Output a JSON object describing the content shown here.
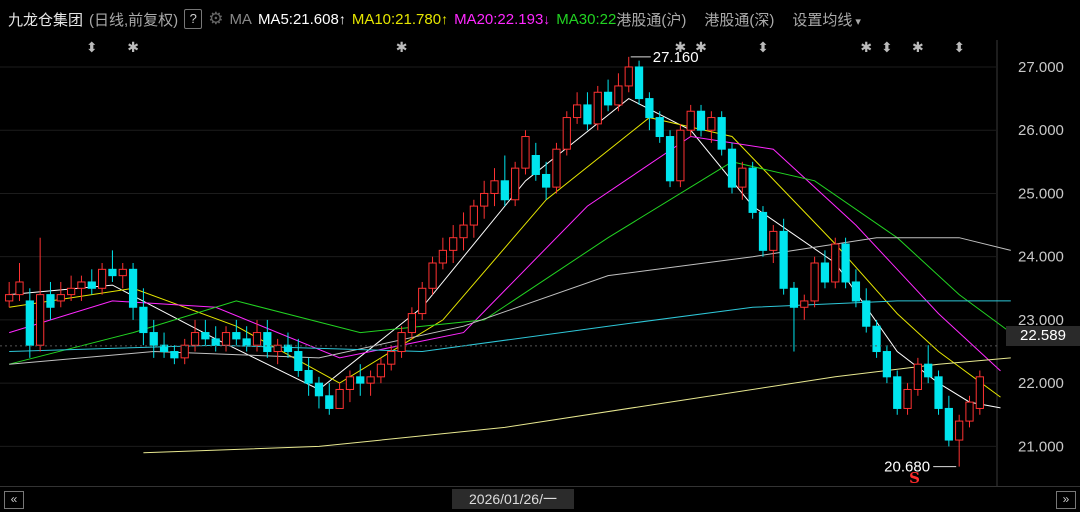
{
  "header": {
    "stock_name": "九龙仓集团",
    "mode": "(日线,前复权)",
    "help": "?",
    "ma_label": "MA",
    "ma5": {
      "text": "MA5:21.608",
      "arrow": "↑",
      "color": "#ffffff"
    },
    "ma10": {
      "text": "MA10:21.780",
      "arrow": "↑",
      "color": "#e6e600"
    },
    "ma20": {
      "text": "MA20:22.193",
      "arrow": "↓",
      "color": "#ff28ff"
    },
    "ma30": {
      "text": "MA30:22",
      "color": "#22d322"
    },
    "link_sh": "港股通(沪)",
    "link_sz": "港股通(深)",
    "settings": "设置均线",
    "settings_caret": "▾"
  },
  "axis": {
    "ticks": [
      "27.000",
      "26.000",
      "25.000",
      "24.000",
      "23.000",
      "22.000",
      "21.000"
    ],
    "current_price": "22.589"
  },
  "annotations": {
    "high": "27.160",
    "low": "20.680",
    "s_marker": "S"
  },
  "bottom": {
    "date": "2026/01/26/一",
    "left_btn": "«",
    "right_btn": "»"
  },
  "chart_data": {
    "type": "candlestick",
    "ylim": [
      20.5,
      27.3
    ],
    "up_color": "#ff3232",
    "down_color": "#00e5ee",
    "candles_ohlc": [
      [
        23.3,
        23.6,
        23.2,
        23.4
      ],
      [
        23.4,
        23.9,
        23.3,
        23.6
      ],
      [
        23.3,
        23.5,
        22.4,
        22.6
      ],
      [
        22.6,
        24.3,
        22.5,
        23.4
      ],
      [
        23.4,
        23.6,
        23.0,
        23.2
      ],
      [
        23.3,
        23.6,
        23.2,
        23.4
      ],
      [
        23.4,
        23.7,
        23.3,
        23.5
      ],
      [
        23.5,
        23.7,
        23.3,
        23.6
      ],
      [
        23.6,
        23.8,
        23.4,
        23.5
      ],
      [
        23.5,
        23.9,
        23.4,
        23.8
      ],
      [
        23.8,
        24.1,
        23.6,
        23.7
      ],
      [
        23.7,
        23.9,
        23.5,
        23.8
      ],
      [
        23.8,
        23.9,
        23.0,
        23.2
      ],
      [
        23.2,
        23.5,
        22.6,
        22.8
      ],
      [
        22.8,
        23.0,
        22.4,
        22.6
      ],
      [
        22.6,
        22.8,
        22.4,
        22.5
      ],
      [
        22.5,
        22.6,
        22.3,
        22.4
      ],
      [
        22.4,
        22.7,
        22.3,
        22.6
      ],
      [
        22.6,
        23.0,
        22.5,
        22.8
      ],
      [
        22.8,
        23.0,
        22.6,
        22.7
      ],
      [
        22.7,
        22.9,
        22.5,
        22.6
      ],
      [
        22.6,
        22.9,
        22.5,
        22.8
      ],
      [
        22.8,
        23.0,
        22.6,
        22.7
      ],
      [
        22.7,
        22.9,
        22.5,
        22.6
      ],
      [
        22.6,
        23.0,
        22.5,
        22.8
      ],
      [
        22.8,
        23.0,
        22.4,
        22.5
      ],
      [
        22.5,
        22.7,
        22.3,
        22.6
      ],
      [
        22.6,
        22.8,
        22.4,
        22.5
      ],
      [
        22.5,
        22.7,
        22.1,
        22.2
      ],
      [
        22.2,
        22.4,
        21.8,
        22.0
      ],
      [
        22.0,
        22.1,
        21.6,
        21.8
      ],
      [
        21.8,
        22.0,
        21.5,
        21.6
      ],
      [
        21.6,
        22.0,
        21.6,
        21.9
      ],
      [
        21.9,
        22.2,
        21.7,
        22.1
      ],
      [
        22.1,
        22.3,
        21.8,
        22.0
      ],
      [
        22.0,
        22.2,
        21.8,
        22.1
      ],
      [
        22.1,
        22.4,
        22.0,
        22.3
      ],
      [
        22.3,
        22.6,
        22.2,
        22.5
      ],
      [
        22.5,
        22.9,
        22.4,
        22.8
      ],
      [
        22.8,
        23.2,
        22.7,
        23.1
      ],
      [
        23.1,
        23.6,
        23.0,
        23.5
      ],
      [
        23.5,
        24.0,
        23.4,
        23.9
      ],
      [
        23.9,
        24.3,
        23.8,
        24.1
      ],
      [
        24.1,
        24.5,
        23.9,
        24.3
      ],
      [
        24.3,
        24.7,
        24.1,
        24.5
      ],
      [
        24.5,
        24.9,
        24.3,
        24.8
      ],
      [
        24.8,
        25.2,
        24.6,
        25.0
      ],
      [
        25.0,
        25.4,
        24.8,
        25.2
      ],
      [
        25.2,
        25.6,
        24.8,
        24.9
      ],
      [
        24.9,
        25.5,
        24.8,
        25.4
      ],
      [
        25.4,
        26.0,
        25.3,
        25.9
      ],
      [
        25.6,
        25.8,
        25.2,
        25.3
      ],
      [
        25.3,
        25.5,
        24.9,
        25.1
      ],
      [
        25.1,
        25.8,
        25.0,
        25.7
      ],
      [
        25.7,
        26.3,
        25.6,
        26.2
      ],
      [
        26.2,
        26.6,
        26.1,
        26.4
      ],
      [
        26.4,
        26.6,
        26.0,
        26.1
      ],
      [
        26.1,
        26.7,
        26.0,
        26.6
      ],
      [
        26.6,
        26.8,
        26.3,
        26.4
      ],
      [
        26.4,
        26.9,
        26.3,
        26.7
      ],
      [
        26.7,
        27.16,
        26.6,
        27.0
      ],
      [
        27.0,
        27.1,
        26.4,
        26.5
      ],
      [
        26.5,
        26.6,
        26.0,
        26.2
      ],
      [
        26.2,
        26.3,
        25.8,
        25.9
      ],
      [
        25.9,
        26.0,
        25.1,
        25.2
      ],
      [
        25.2,
        26.1,
        25.1,
        26.0
      ],
      [
        26.0,
        26.4,
        25.9,
        26.3
      ],
      [
        26.3,
        26.4,
        25.9,
        26.0
      ],
      [
        26.0,
        26.3,
        25.8,
        26.2
      ],
      [
        26.2,
        26.3,
        25.6,
        25.7
      ],
      [
        25.7,
        25.8,
        25.0,
        25.1
      ],
      [
        25.1,
        25.5,
        24.9,
        25.4
      ],
      [
        25.4,
        25.5,
        24.6,
        24.7
      ],
      [
        24.7,
        24.8,
        24.0,
        24.1
      ],
      [
        24.1,
        24.5,
        23.9,
        24.4
      ],
      [
        24.4,
        24.6,
        23.4,
        23.5
      ],
      [
        23.5,
        23.6,
        22.5,
        23.2
      ],
      [
        23.2,
        23.4,
        23.0,
        23.3
      ],
      [
        23.3,
        24.0,
        23.2,
        23.9
      ],
      [
        23.9,
        24.1,
        23.5,
        23.6
      ],
      [
        23.6,
        24.3,
        23.5,
        24.2
      ],
      [
        24.2,
        24.3,
        23.5,
        23.6
      ],
      [
        23.6,
        23.8,
        23.2,
        23.3
      ],
      [
        23.3,
        23.5,
        22.8,
        22.9
      ],
      [
        22.9,
        23.0,
        22.4,
        22.5
      ],
      [
        22.5,
        22.6,
        22.0,
        22.1
      ],
      [
        22.1,
        22.2,
        21.5,
        21.6
      ],
      [
        21.6,
        22.0,
        21.5,
        21.9
      ],
      [
        21.9,
        22.4,
        21.8,
        22.3
      ],
      [
        22.3,
        22.6,
        22.0,
        22.1
      ],
      [
        22.1,
        22.2,
        21.5,
        21.6
      ],
      [
        21.6,
        21.8,
        21.0,
        21.1
      ],
      [
        21.1,
        21.5,
        20.68,
        21.4
      ],
      [
        21.4,
        21.8,
        21.3,
        21.7
      ],
      [
        21.6,
        22.2,
        21.5,
        22.1
      ]
    ],
    "ma_lines": [
      {
        "name": "MA5",
        "color": "#ffffff",
        "points": [
          [
            0,
            23.4
          ],
          [
            10,
            23.55
          ],
          [
            20,
            22.7
          ],
          [
            30,
            21.9
          ],
          [
            40,
            23.2
          ],
          [
            50,
            25.2
          ],
          [
            60,
            26.5
          ],
          [
            66,
            26.0
          ],
          [
            72,
            24.8
          ],
          [
            80,
            23.9
          ],
          [
            86,
            22.5
          ],
          [
            90,
            22.0
          ],
          [
            93,
            21.7
          ],
          [
            96,
            21.608
          ]
        ]
      },
      {
        "name": "MA10",
        "color": "#e6e600",
        "points": [
          [
            0,
            23.2
          ],
          [
            12,
            23.5
          ],
          [
            22,
            22.9
          ],
          [
            32,
            22.0
          ],
          [
            42,
            23.0
          ],
          [
            52,
            24.9
          ],
          [
            62,
            26.2
          ],
          [
            70,
            25.9
          ],
          [
            80,
            24.2
          ],
          [
            86,
            23.1
          ],
          [
            90,
            22.5
          ],
          [
            96,
            21.78
          ]
        ]
      },
      {
        "name": "MA20",
        "color": "#ff28ff",
        "points": [
          [
            0,
            22.8
          ],
          [
            10,
            23.3
          ],
          [
            20,
            23.2
          ],
          [
            32,
            22.4
          ],
          [
            44,
            22.8
          ],
          [
            56,
            24.8
          ],
          [
            66,
            25.9
          ],
          [
            74,
            25.7
          ],
          [
            82,
            24.5
          ],
          [
            90,
            23.1
          ],
          [
            96,
            22.193
          ]
        ]
      },
      {
        "name": "MA30",
        "color": "#22d322",
        "points": [
          [
            0,
            22.3
          ],
          [
            12,
            22.8
          ],
          [
            22,
            23.3
          ],
          [
            34,
            22.8
          ],
          [
            46,
            23.0
          ],
          [
            58,
            24.3
          ],
          [
            70,
            25.5
          ],
          [
            78,
            25.2
          ],
          [
            86,
            24.3
          ],
          [
            92,
            23.4
          ],
          [
            97,
            22.8
          ]
        ]
      },
      {
        "name": "MA60",
        "color": "#c0c0c0",
        "points": [
          [
            0,
            22.3
          ],
          [
            14,
            22.5
          ],
          [
            30,
            22.4
          ],
          [
            44,
            22.9
          ],
          [
            58,
            23.7
          ],
          [
            72,
            24.0
          ],
          [
            84,
            24.3
          ],
          [
            92,
            24.3
          ],
          [
            97,
            24.1
          ]
        ]
      },
      {
        "name": "MA120",
        "color": "#2ec7d8",
        "points": [
          [
            0,
            22.5
          ],
          [
            20,
            22.6
          ],
          [
            40,
            22.5
          ],
          [
            58,
            22.9
          ],
          [
            72,
            23.2
          ],
          [
            86,
            23.3
          ],
          [
            97,
            23.3
          ]
        ]
      },
      {
        "name": "MA250",
        "color": "#e8e890",
        "points": [
          [
            13,
            20.9
          ],
          [
            30,
            21.0
          ],
          [
            48,
            21.3
          ],
          [
            64,
            21.7
          ],
          [
            80,
            22.1
          ],
          [
            90,
            22.3
          ],
          [
            97,
            22.4
          ]
        ]
      }
    ],
    "event_markers": [
      {
        "index": 8,
        "symbol": "⬍",
        "color": "#bbbbbb"
      },
      {
        "index": 12,
        "symbol": "✱",
        "color": "#bbbbbb"
      },
      {
        "index": 38,
        "symbol": "✱",
        "color": "#bbbbbb"
      },
      {
        "index": 65,
        "symbol": "✱",
        "color": "#bbbbbb"
      },
      {
        "index": 67,
        "symbol": "✱",
        "color": "#bbbbbb"
      },
      {
        "index": 73,
        "symbol": "⬍",
        "color": "#bbbbbb"
      },
      {
        "index": 83,
        "symbol": "✱",
        "color": "#bbbbbb"
      },
      {
        "index": 85,
        "symbol": "⬍",
        "color": "#bbbbbb"
      },
      {
        "index": 88,
        "symbol": "✱",
        "color": "#bbbbbb"
      },
      {
        "index": 92,
        "symbol": "⬍",
        "color": "#bbbbbb"
      }
    ]
  }
}
